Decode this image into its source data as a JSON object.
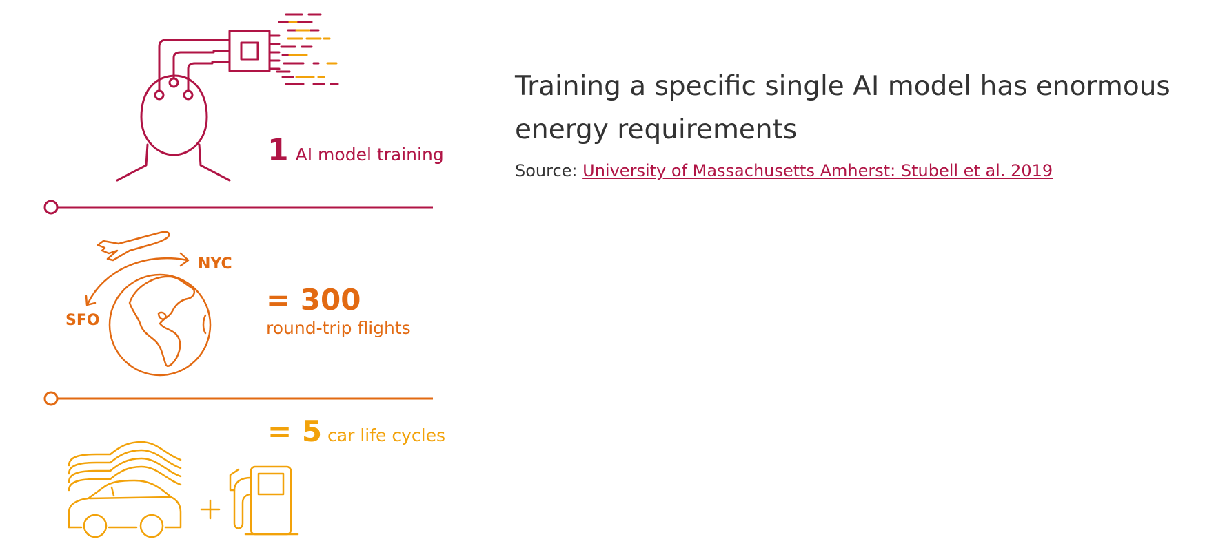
{
  "colors": {
    "crimson": "#b01445",
    "orange": "#e26a12",
    "amber": "#f2a20a",
    "text": "#333333"
  },
  "infographic": {
    "training": {
      "value": "1",
      "label": "AI model training",
      "icon": "head-with-chip-icon"
    },
    "flights": {
      "value": "= 300",
      "label": "round-trip flights",
      "origin": "SFO",
      "destination": "NYC",
      "icon": "globe-airplane-icon"
    },
    "cars": {
      "value": "= 5",
      "label": "car life cycles",
      "icon": "stacked-cars-plus-fuel-pump-icon"
    }
  },
  "headline": {
    "title": "Training a specific single AI model has enormous energy requirements",
    "source_prefix": "Source:",
    "source_link": "University of Massachusetts Amherst: Stubell et al. 2019"
  }
}
